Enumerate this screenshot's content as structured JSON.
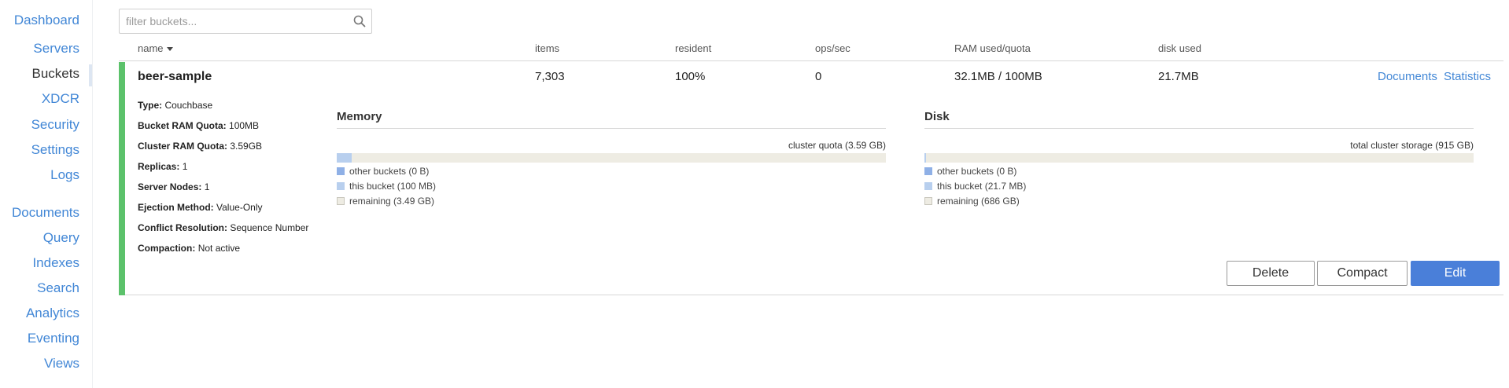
{
  "sidebar": {
    "items": [
      {
        "label": "Dashboard"
      },
      {
        "label": "Servers"
      },
      {
        "label": "Buckets"
      },
      {
        "label": "XDCR"
      },
      {
        "label": "Security"
      },
      {
        "label": "Settings"
      },
      {
        "label": "Logs"
      },
      {
        "label": "Documents"
      },
      {
        "label": "Query"
      },
      {
        "label": "Indexes"
      },
      {
        "label": "Search"
      },
      {
        "label": "Analytics"
      },
      {
        "label": "Eventing"
      },
      {
        "label": "Views"
      }
    ],
    "active": "Buckets"
  },
  "filter": {
    "placeholder": "filter buckets...",
    "value": "",
    "icon": "search-icon"
  },
  "table": {
    "columns": {
      "name": "name",
      "items": "items",
      "resident": "resident",
      "ops": "ops/sec",
      "ram": "RAM used/quota",
      "disk": "disk used"
    },
    "sort": "name-desc"
  },
  "bucket": {
    "name": "beer-sample",
    "items": "7,303",
    "resident": "100%",
    "ops": "0",
    "ram": "32.1MB / 100MB",
    "disk": "21.7MB",
    "status_color": "#5cc26b",
    "links": {
      "documents": "Documents",
      "statistics": "Statistics"
    },
    "details": [
      {
        "label": "Type:",
        "value": "Couchbase"
      },
      {
        "label": "Bucket RAM Quota:",
        "value": "100MB"
      },
      {
        "label": "Cluster RAM Quota:",
        "value": "3.59GB"
      },
      {
        "label": "Replicas:",
        "value": "1"
      },
      {
        "label": "Server Nodes:",
        "value": "1"
      },
      {
        "label": "Ejection Method:",
        "value": "Value-Only"
      },
      {
        "label": "Conflict Resolution:",
        "value": "Sequence Number"
      },
      {
        "label": "Compaction:",
        "value": "Not active"
      }
    ],
    "memory": {
      "title": "Memory",
      "quota_label": "cluster quota (3.59 GB)",
      "this_bucket_fraction": 0.027,
      "legend": {
        "other": "other buckets (0 B)",
        "this": "this bucket (100 MB)",
        "remaining": "remaining (3.49 GB)"
      }
    },
    "disk_usage": {
      "title": "Disk",
      "quota_label": "total cluster storage (915 GB)",
      "this_bucket_fraction": 2e-05,
      "legend": {
        "other": "other buckets (0 B)",
        "this": "this bucket (21.7 MB)",
        "remaining": "remaining (686 GB)"
      }
    },
    "buttons": {
      "delete": "Delete",
      "compact": "Compact",
      "edit": "Edit"
    }
  },
  "colors": {
    "link": "#4287d6",
    "primary_button": "#4a7fd9",
    "legend_other": "#8fb0e6",
    "legend_this": "#b8cfee",
    "legend_remaining": "#eeece3"
  }
}
